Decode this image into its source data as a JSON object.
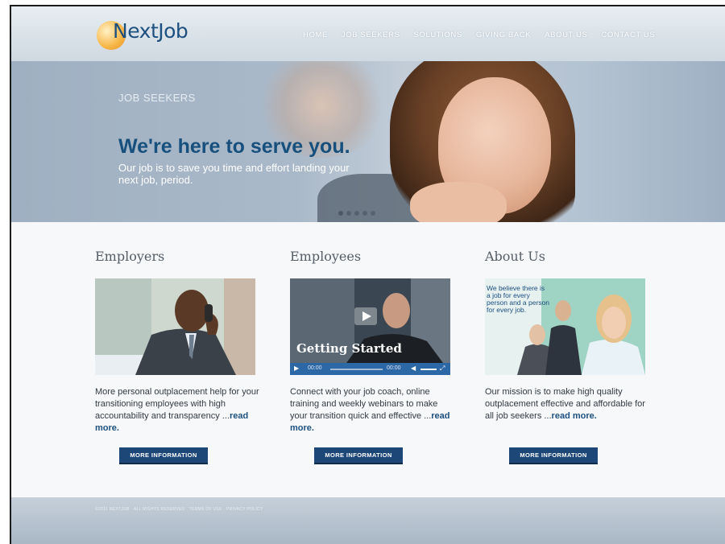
{
  "logo": {
    "text": "NextJob"
  },
  "nav": {
    "items": [
      "HOME",
      "JOB SEEKERS",
      "SOLUTIONS",
      "GIVING BACK",
      "ABOUT US",
      "CONTACT US"
    ]
  },
  "hero": {
    "eyebrow": "JOB SEEKERS",
    "title": "We're here to serve you.",
    "text": "Our job is to save you time and effort landing your next job, period."
  },
  "columns": [
    {
      "title": "Employers",
      "text": "More personal outplacement help for your transitioning employees with high accountability and transparency ...",
      "link": "read more.",
      "button": "MORE INFORMATION"
    },
    {
      "title": "Employees",
      "text": "Connect with your job coach, online training and weekly webinars to make your transition quick and effective ...",
      "link": "read more.",
      "button": "MORE INFORMATION"
    },
    {
      "title": "About Us",
      "text": "Our mission is to make high quality outplacement effective and affordable for all job seekers ...",
      "link": "read more.",
      "button": "MORE INFORMATION"
    }
  ],
  "video": {
    "overlay_title": "Getting Started",
    "time_current": "00:00",
    "time_total": "00:00"
  },
  "about_image": {
    "caption": "We believe there is a job for every person and a person for every job."
  },
  "footer": {
    "text": "©2011 NEXTJOB · ALL RIGHTS RESERVED · TERMS OF USE · PRIVACY POLICY"
  },
  "colors": {
    "brand": "#1d4f7f",
    "button": "#1d4777",
    "hero_bg": "#aab9c9"
  }
}
